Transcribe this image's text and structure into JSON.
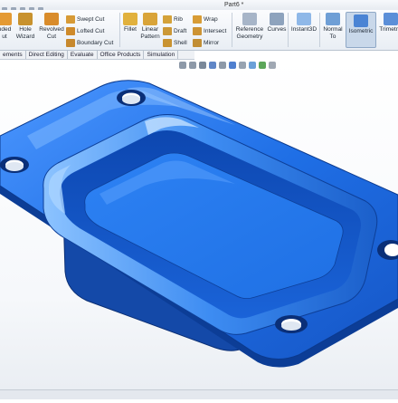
{
  "window": {
    "title": "Part6 *"
  },
  "ribbon": {
    "extruded_label_a": "uded",
    "extruded_label_b": "ut",
    "hole_wizard_a": "Hole",
    "hole_wizard_b": "Wizard",
    "revolved_cut_a": "Revolved",
    "revolved_cut_b": "Cut",
    "swept_cut": "Swept Cut",
    "lofted_cut": "Lofted Cut",
    "boundary_cut": "Boundary Cut",
    "fillet": "Fillet",
    "linear_pattern_a": "Linear",
    "linear_pattern_b": "Pattern",
    "rib": "Rib",
    "draft": "Draft",
    "shell": "Shell",
    "wrap": "Wrap",
    "intersect": "Intersect",
    "mirror": "Mirror",
    "reference_geometry_a": "Reference",
    "reference_geometry_b": "Geometry",
    "curves": "Curves",
    "instant3d": "Instant3D",
    "normal_to_a": "Normal",
    "normal_to_b": "To",
    "isometric": "Isometric",
    "trimetric": "Trimetric"
  },
  "tabs": [
    "ements",
    "Direct Editing",
    "Evaluate",
    "Office Products",
    "Simulation"
  ],
  "colors": {
    "part_blue": "#1f6fe6",
    "part_dark": "#0a3f9a",
    "part_light": "#6fb0ff",
    "ribbon_bg": "#eef2f7"
  },
  "icons": [
    "extrude-cut-icon",
    "hole-wizard-icon",
    "revolved-cut-icon",
    "swept-cut-icon",
    "lofted-cut-icon",
    "boundary-cut-icon",
    "fillet-icon",
    "linear-pattern-icon",
    "rib-icon",
    "draft-icon",
    "shell-icon",
    "wrap-icon",
    "intersect-icon",
    "mirror-icon",
    "reference-geometry-icon",
    "curves-icon",
    "instant3d-icon",
    "normal-to-icon",
    "isometric-icon",
    "trimetric-icon"
  ]
}
